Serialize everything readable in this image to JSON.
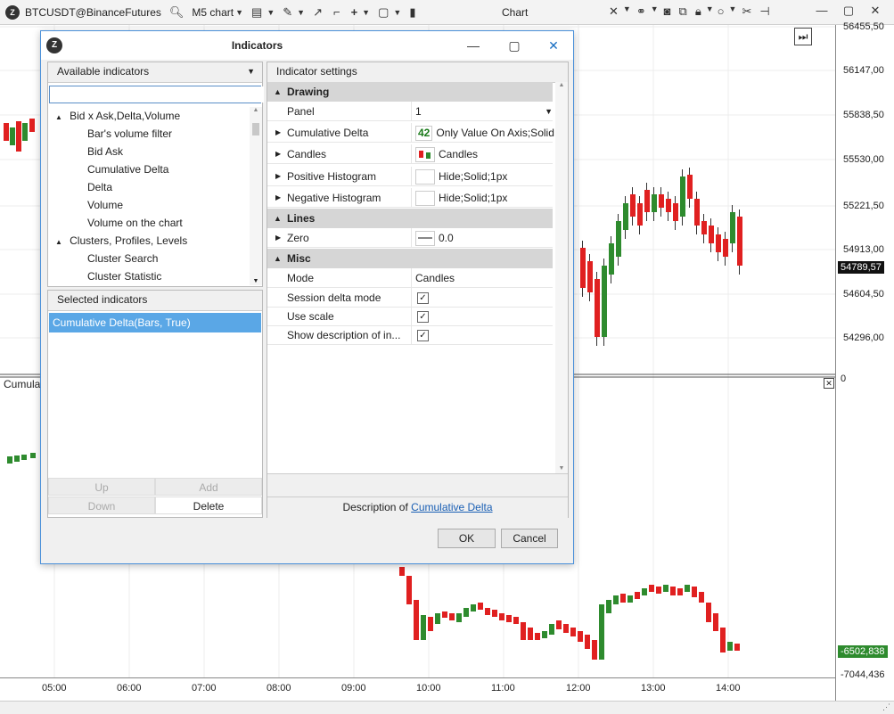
{
  "toolbar": {
    "symbol": "BTCUSDT@BinanceFutures",
    "timeframe": "M5 chart",
    "title": "Chart"
  },
  "price_scale": {
    "labels": [
      "56455,50",
      "56147,00",
      "55838,50",
      "55530,00",
      "55221,50",
      "54913,00",
      "54604,50",
      "54296,00"
    ],
    "current_price": "54789,57",
    "zero_label": "0",
    "delta_value": "-6502,838",
    "delta_min": "-7044,436"
  },
  "time_axis": [
    "05:00",
    "06:00",
    "07:00",
    "08:00",
    "09:00",
    "10:00",
    "11:00",
    "12:00",
    "13:00",
    "14:00"
  ],
  "lower_panel_label": "Cumula",
  "dialog": {
    "title": "Indicators",
    "available_header": "Available indicators",
    "search_value": "",
    "available_tree": [
      {
        "label": "Bid x Ask,Delta,Volume",
        "group": true
      },
      {
        "label": "Bar's volume filter",
        "group": false
      },
      {
        "label": "Bid Ask",
        "group": false
      },
      {
        "label": "Cumulative Delta",
        "group": false
      },
      {
        "label": "Delta",
        "group": false
      },
      {
        "label": "Volume",
        "group": false
      },
      {
        "label": "Volume on the chart",
        "group": false
      },
      {
        "label": "Clusters, Profiles, Levels",
        "group": true
      },
      {
        "label": "Cluster Search",
        "group": false
      },
      {
        "label": "Cluster Statistic",
        "group": false
      }
    ],
    "selected_header": "Selected indicators",
    "selected_items": [
      "Cumulative Delta(Bars, True)"
    ],
    "buttons": {
      "up": "Up",
      "add": "Add",
      "down": "Down",
      "delete": "Delete"
    },
    "settings_header": "Indicator settings",
    "sections": {
      "drawing": "Drawing",
      "lines": "Lines",
      "misc": "Misc"
    },
    "settings": {
      "panel": {
        "label": "Panel",
        "value": "1"
      },
      "cumulative_delta": {
        "label": "Cumulative Delta",
        "badge": "42",
        "value": "Only Value On Axis;Solid"
      },
      "candles": {
        "label": "Candles",
        "value": "Candles"
      },
      "positive_histogram": {
        "label": "Positive Histogram",
        "value": "Hide;Solid;1px"
      },
      "negative_histogram": {
        "label": "Negative Histogram",
        "value": "Hide;Solid;1px"
      },
      "zero": {
        "label": "Zero",
        "value": "0.0"
      },
      "mode": {
        "label": "Mode",
        "value": "Candles"
      },
      "session_delta_mode": {
        "label": "Session delta mode"
      },
      "use_scale": {
        "label": "Use scale"
      },
      "show_description": {
        "label": "Show description of in..."
      }
    },
    "description_prefix": "Description of ",
    "description_link": "Cumulative Delta",
    "ok": "OK",
    "cancel": "Cancel"
  },
  "colors": {
    "up": "#2e8b2e",
    "down": "#e02020",
    "accent": "#4a90d9",
    "selected": "#5aa7e6",
    "current_price_bg": "#111111",
    "delta_bg": "#2e8b2e"
  }
}
